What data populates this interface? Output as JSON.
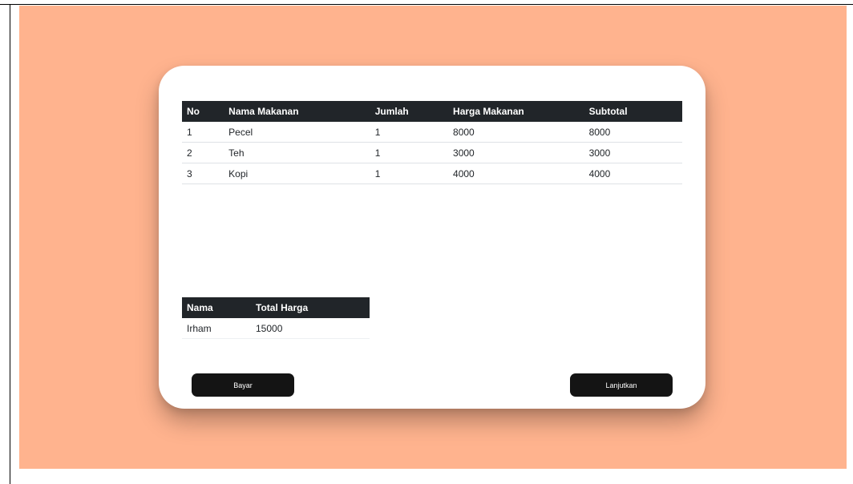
{
  "items_table": {
    "headers": [
      "No",
      "Nama Makanan",
      "Jumlah",
      "Harga Makanan",
      "Subtotal"
    ],
    "rows": [
      [
        "1",
        "Pecel",
        "1",
        "8000",
        "8000"
      ],
      [
        "2",
        "Teh",
        "1",
        "3000",
        "3000"
      ],
      [
        "3",
        "Kopi",
        "1",
        "4000",
        "4000"
      ]
    ]
  },
  "summary_table": {
    "headers": [
      "Nama",
      "Total Harga"
    ],
    "rows": [
      [
        "Irham",
        "15000"
      ]
    ]
  },
  "buttons": {
    "bayar_label": "Bayar",
    "lanjutkan_label": "Lanjutkan"
  },
  "colors": {
    "background": "#ffb38e",
    "card": "#ffffff",
    "table_header": "#212529",
    "button": "#141414"
  }
}
